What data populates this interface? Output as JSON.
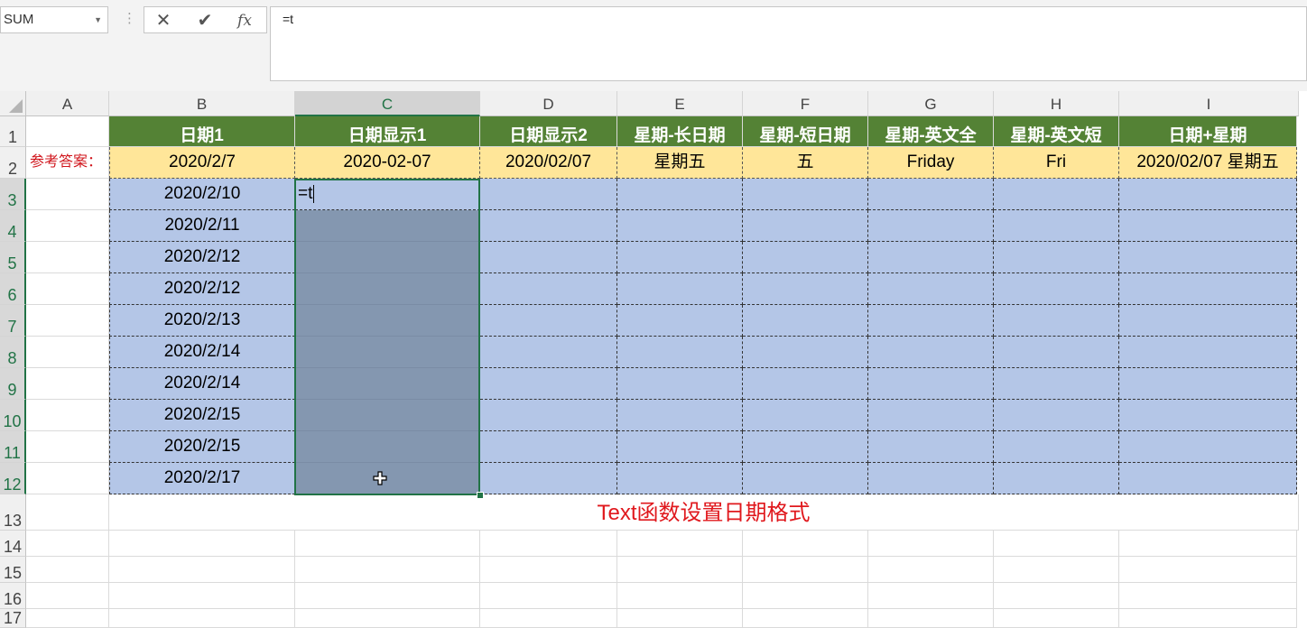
{
  "formula_bar": {
    "name_box": "SUM",
    "cancel_icon": "✕",
    "enter_icon": "✔",
    "fx_label": "fx",
    "formula": "=t"
  },
  "columns": [
    "A",
    "B",
    "C",
    "D",
    "E",
    "F",
    "G",
    "H",
    "I"
  ],
  "rows": [
    "1",
    "2",
    "3",
    "4",
    "5",
    "6",
    "7",
    "8",
    "9",
    "10",
    "11",
    "12",
    "13",
    "14",
    "15",
    "16",
    "17"
  ],
  "headers": [
    "日期1",
    "日期显示1",
    "日期显示2",
    "星期-长日期",
    "星期-短日期",
    "星期-英文全",
    "星期-英文短",
    "日期+星期"
  ],
  "reference_label": "参考答案：",
  "answers": [
    "2020/2/7",
    "2020-02-07",
    "2020/02/07",
    "星期五",
    "五",
    "Friday",
    "Fri",
    "2020/02/07 星期五"
  ],
  "dates": [
    "2020/2/10",
    "2020/2/11",
    "2020/2/12",
    "2020/2/12",
    "2020/2/13",
    "2020/2/14",
    "2020/2/14",
    "2020/2/15",
    "2020/2/15",
    "2020/2/17"
  ],
  "active_cell_text": "=t",
  "note": "Text函数设置日期格式",
  "colors": {
    "header_green": "#548235",
    "answer_yellow": "#ffe699",
    "range_blue": "#b4c6e7",
    "selection_grey": "#8497b0",
    "accent": "#217346",
    "note_red": "#e0181d"
  }
}
